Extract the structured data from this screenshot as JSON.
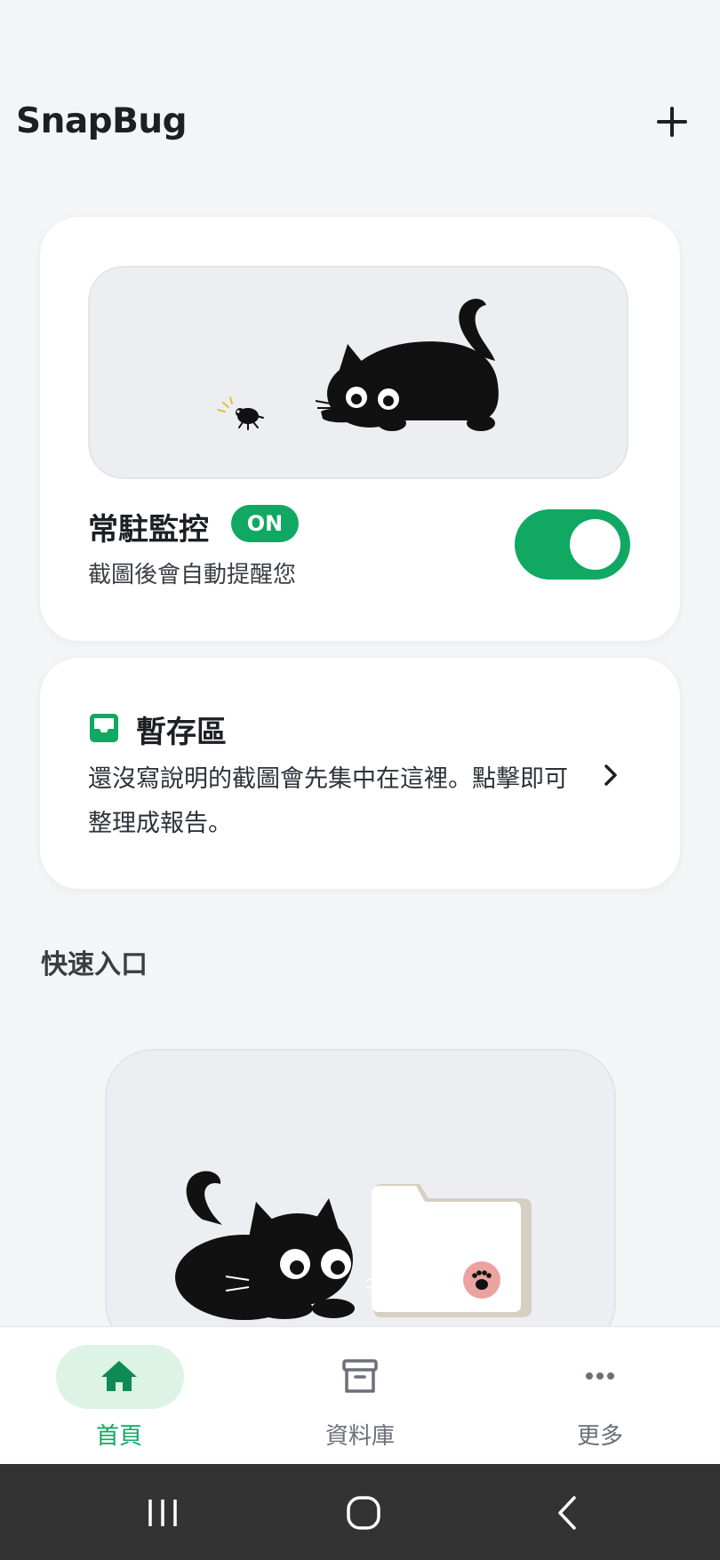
{
  "header": {
    "title": "SnapBug",
    "add_icon": "plus-icon"
  },
  "monitor_card": {
    "title": "常駐監控",
    "badge": "ON",
    "subtitle": "截圖後會自動提醒您",
    "toggle_on": true,
    "accent_color": "#10a862"
  },
  "stash_card": {
    "icon": "inbox-icon",
    "title": "暫存區",
    "description": "還沒寫說明的截圖會先集中在這裡。點擊即可整理成報告。",
    "chevron_icon": "chevron-right-icon"
  },
  "quick_access": {
    "title": "快速入口"
  },
  "bottom_nav": {
    "items": [
      {
        "label": "首頁",
        "icon": "home-icon",
        "active": true
      },
      {
        "label": "資料庫",
        "icon": "archive-box-icon",
        "active": false
      },
      {
        "label": "更多",
        "icon": "more-dots-icon",
        "active": false
      }
    ]
  },
  "system_nav": {
    "recents_icon": "recents-icon",
    "home_icon": "home-circle-icon",
    "back_icon": "back-icon"
  }
}
